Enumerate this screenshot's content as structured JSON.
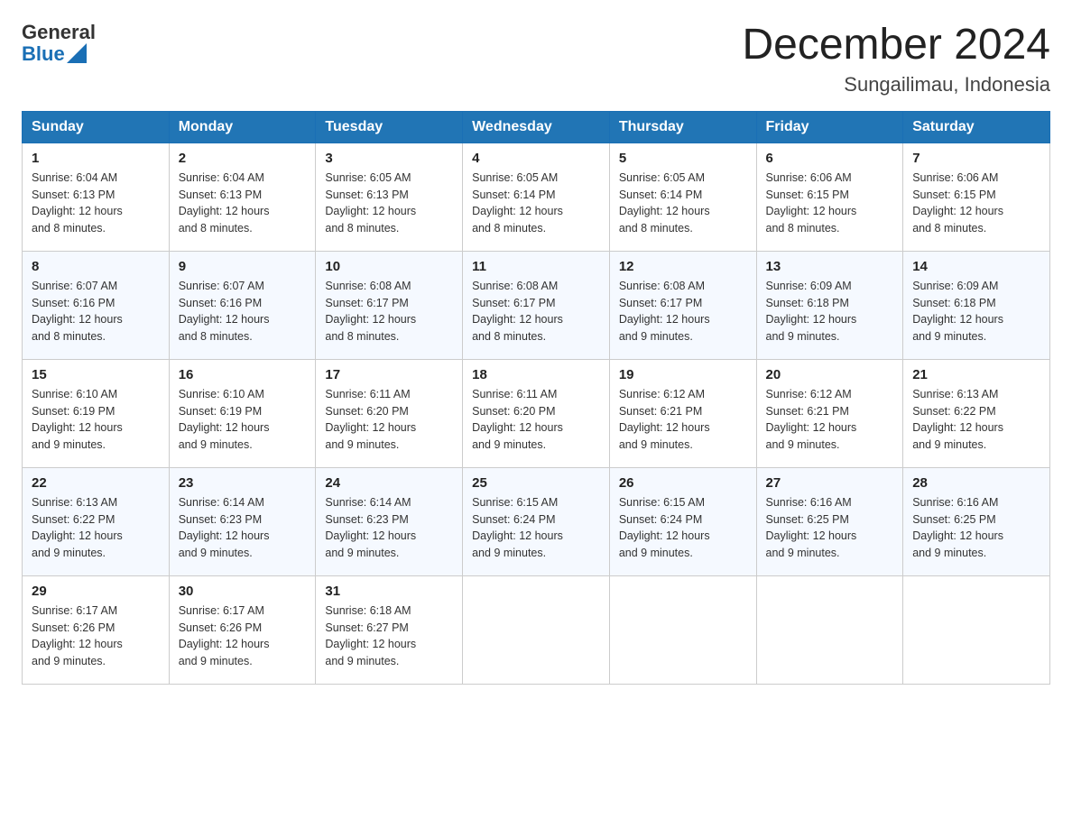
{
  "header": {
    "logo_general": "General",
    "logo_blue": "Blue",
    "month_title": "December 2024",
    "subtitle": "Sungailimau, Indonesia"
  },
  "days_of_week": [
    "Sunday",
    "Monday",
    "Tuesday",
    "Wednesday",
    "Thursday",
    "Friday",
    "Saturday"
  ],
  "weeks": [
    [
      {
        "day": "1",
        "sunrise": "6:04 AM",
        "sunset": "6:13 PM",
        "daylight": "12 hours and 8 minutes."
      },
      {
        "day": "2",
        "sunrise": "6:04 AM",
        "sunset": "6:13 PM",
        "daylight": "12 hours and 8 minutes."
      },
      {
        "day": "3",
        "sunrise": "6:05 AM",
        "sunset": "6:13 PM",
        "daylight": "12 hours and 8 minutes."
      },
      {
        "day": "4",
        "sunrise": "6:05 AM",
        "sunset": "6:14 PM",
        "daylight": "12 hours and 8 minutes."
      },
      {
        "day": "5",
        "sunrise": "6:05 AM",
        "sunset": "6:14 PM",
        "daylight": "12 hours and 8 minutes."
      },
      {
        "day": "6",
        "sunrise": "6:06 AM",
        "sunset": "6:15 PM",
        "daylight": "12 hours and 8 minutes."
      },
      {
        "day": "7",
        "sunrise": "6:06 AM",
        "sunset": "6:15 PM",
        "daylight": "12 hours and 8 minutes."
      }
    ],
    [
      {
        "day": "8",
        "sunrise": "6:07 AM",
        "sunset": "6:16 PM",
        "daylight": "12 hours and 8 minutes."
      },
      {
        "day": "9",
        "sunrise": "6:07 AM",
        "sunset": "6:16 PM",
        "daylight": "12 hours and 8 minutes."
      },
      {
        "day": "10",
        "sunrise": "6:08 AM",
        "sunset": "6:17 PM",
        "daylight": "12 hours and 8 minutes."
      },
      {
        "day": "11",
        "sunrise": "6:08 AM",
        "sunset": "6:17 PM",
        "daylight": "12 hours and 8 minutes."
      },
      {
        "day": "12",
        "sunrise": "6:08 AM",
        "sunset": "6:17 PM",
        "daylight": "12 hours and 9 minutes."
      },
      {
        "day": "13",
        "sunrise": "6:09 AM",
        "sunset": "6:18 PM",
        "daylight": "12 hours and 9 minutes."
      },
      {
        "day": "14",
        "sunrise": "6:09 AM",
        "sunset": "6:18 PM",
        "daylight": "12 hours and 9 minutes."
      }
    ],
    [
      {
        "day": "15",
        "sunrise": "6:10 AM",
        "sunset": "6:19 PM",
        "daylight": "12 hours and 9 minutes."
      },
      {
        "day": "16",
        "sunrise": "6:10 AM",
        "sunset": "6:19 PM",
        "daylight": "12 hours and 9 minutes."
      },
      {
        "day": "17",
        "sunrise": "6:11 AM",
        "sunset": "6:20 PM",
        "daylight": "12 hours and 9 minutes."
      },
      {
        "day": "18",
        "sunrise": "6:11 AM",
        "sunset": "6:20 PM",
        "daylight": "12 hours and 9 minutes."
      },
      {
        "day": "19",
        "sunrise": "6:12 AM",
        "sunset": "6:21 PM",
        "daylight": "12 hours and 9 minutes."
      },
      {
        "day": "20",
        "sunrise": "6:12 AM",
        "sunset": "6:21 PM",
        "daylight": "12 hours and 9 minutes."
      },
      {
        "day": "21",
        "sunrise": "6:13 AM",
        "sunset": "6:22 PM",
        "daylight": "12 hours and 9 minutes."
      }
    ],
    [
      {
        "day": "22",
        "sunrise": "6:13 AM",
        "sunset": "6:22 PM",
        "daylight": "12 hours and 9 minutes."
      },
      {
        "day": "23",
        "sunrise": "6:14 AM",
        "sunset": "6:23 PM",
        "daylight": "12 hours and 9 minutes."
      },
      {
        "day": "24",
        "sunrise": "6:14 AM",
        "sunset": "6:23 PM",
        "daylight": "12 hours and 9 minutes."
      },
      {
        "day": "25",
        "sunrise": "6:15 AM",
        "sunset": "6:24 PM",
        "daylight": "12 hours and 9 minutes."
      },
      {
        "day": "26",
        "sunrise": "6:15 AM",
        "sunset": "6:24 PM",
        "daylight": "12 hours and 9 minutes."
      },
      {
        "day": "27",
        "sunrise": "6:16 AM",
        "sunset": "6:25 PM",
        "daylight": "12 hours and 9 minutes."
      },
      {
        "day": "28",
        "sunrise": "6:16 AM",
        "sunset": "6:25 PM",
        "daylight": "12 hours and 9 minutes."
      }
    ],
    [
      {
        "day": "29",
        "sunrise": "6:17 AM",
        "sunset": "6:26 PM",
        "daylight": "12 hours and 9 minutes."
      },
      {
        "day": "30",
        "sunrise": "6:17 AM",
        "sunset": "6:26 PM",
        "daylight": "12 hours and 9 minutes."
      },
      {
        "day": "31",
        "sunrise": "6:18 AM",
        "sunset": "6:27 PM",
        "daylight": "12 hours and 9 minutes."
      },
      null,
      null,
      null,
      null
    ]
  ],
  "labels": {
    "sunrise": "Sunrise:",
    "sunset": "Sunset:",
    "daylight": "Daylight:"
  }
}
